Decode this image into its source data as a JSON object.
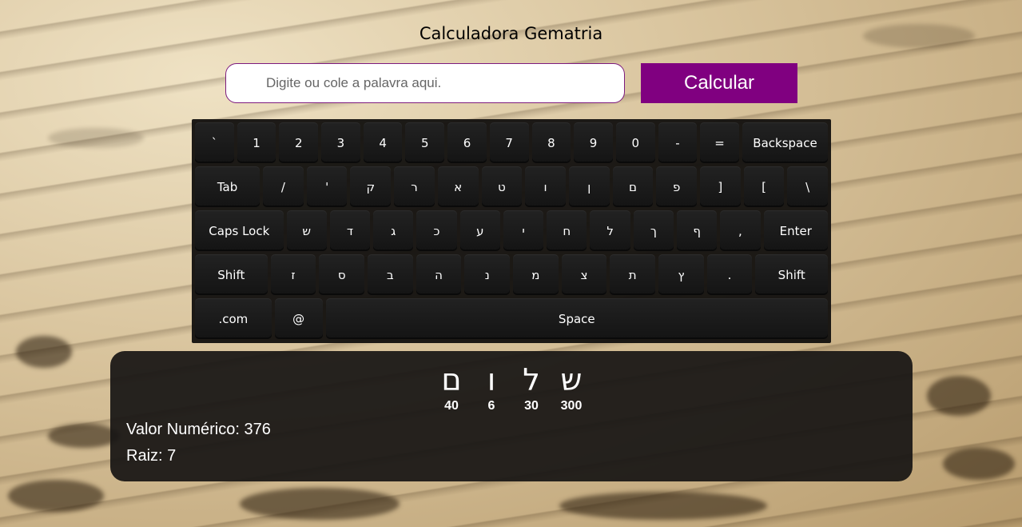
{
  "title": "Calculadora Gematria",
  "input": {
    "placeholder": "Digite ou cole a palavra aqui.",
    "value": ""
  },
  "calculate_label": "Calcular",
  "keyboard": {
    "rows": [
      [
        "`",
        "1",
        "2",
        "3",
        "4",
        "5",
        "6",
        "7",
        "8",
        "9",
        "0",
        "-",
        "=",
        "Backspace"
      ],
      [
        "Tab",
        "/",
        "'",
        "ק",
        "ר",
        "א",
        "ט",
        "ו",
        "ן",
        "ם",
        "פ",
        "]",
        "[",
        "\\"
      ],
      [
        "Caps Lock",
        "ש",
        "ד",
        "ג",
        "כ",
        "ע",
        "י",
        "ח",
        "ל",
        "ך",
        "ף",
        ",",
        "Enter"
      ],
      [
        "Shift",
        "ז",
        "ס",
        "ב",
        "ה",
        "נ",
        "מ",
        "צ",
        "ת",
        "ץ",
        ".",
        "Shift"
      ],
      [
        ".com",
        "@",
        "Space"
      ]
    ]
  },
  "result": {
    "letters": [
      {
        "glyph": "ם",
        "value": "40"
      },
      {
        "glyph": "ו",
        "value": "6"
      },
      {
        "glyph": "ל",
        "value": "30"
      },
      {
        "glyph": "ש",
        "value": "300"
      }
    ],
    "numeric_value": "Valor Numérico: 376",
    "root": "Raiz: 7"
  }
}
